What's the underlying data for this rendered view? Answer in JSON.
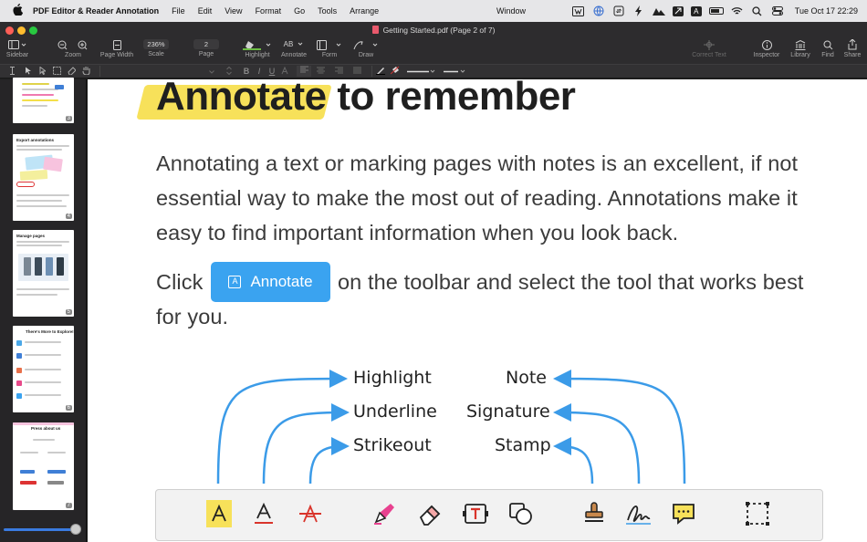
{
  "menubar": {
    "apple": "",
    "app_name": "PDF Editor & Reader Annotation",
    "menus": [
      "File",
      "Edit",
      "View",
      "Format",
      "Go",
      "Tools",
      "Arrange"
    ],
    "center_item": "Window",
    "clock": "Tue Oct 17  22:29",
    "status_box_letter": "A"
  },
  "window": {
    "title": "Getting Started.pdf (Page 2 of 7)"
  },
  "toolbar": {
    "sidebar_label": "Sidebar",
    "zoom_label": "Zoom",
    "page_width_label": "Page Width",
    "scale_value": "236%",
    "scale_label": "Scale",
    "page_value": "2",
    "page_label": "Page",
    "highlight_label": "Highlight",
    "annotate_icon_text": "AB",
    "annotate_label": "Annotate",
    "form_label": "Form",
    "draw_label": "Draw",
    "correct_text_label": "Correct Text",
    "inspector_label": "Inspector",
    "library_label": "Library",
    "find_label": "Find",
    "share_label": "Share"
  },
  "format_bar": {
    "bold": "B",
    "italic": "I",
    "underline": "U"
  },
  "sidebar": {
    "thumbnails": [
      {
        "page": "3",
        "title": ""
      },
      {
        "page": "4",
        "title": "Export annotations"
      },
      {
        "page": "5",
        "title": "Manage pages"
      },
      {
        "page": "6",
        "title": "There's More to Explore!"
      },
      {
        "page": "7",
        "title": "Press about us"
      }
    ],
    "thumb_size_level": 0.92
  },
  "document": {
    "heading_highlighted": "Annotate",
    "heading_rest": " to remember",
    "para1_lines": [
      "Annotating a text or marking pages with notes is an excellent, if not",
      "essential way to make the most out of reading. Annotations make it",
      "easy to find important information when you look back."
    ],
    "para2_before": "Click",
    "para2_after": "on the toolbar and select the tool that works best",
    "para2_line2": "for you.",
    "inline_button_label": "Annotate",
    "inline_button_icon": "A",
    "diagram_left": [
      "Highlight",
      "Underline",
      "Strikeout"
    ],
    "diagram_right": [
      "Note",
      "Signature",
      "Stamp"
    ]
  },
  "colors": {
    "accent_blue": "#3aa3f0",
    "highlight_yellow": "#f7e15a",
    "arrow_blue": "#3b9be8",
    "underline_red": "#d9342b",
    "pen_pink": "#e8418f",
    "traffic_red": "#fe5f57",
    "traffic_yellow": "#febc2e",
    "traffic_green": "#28c840"
  }
}
